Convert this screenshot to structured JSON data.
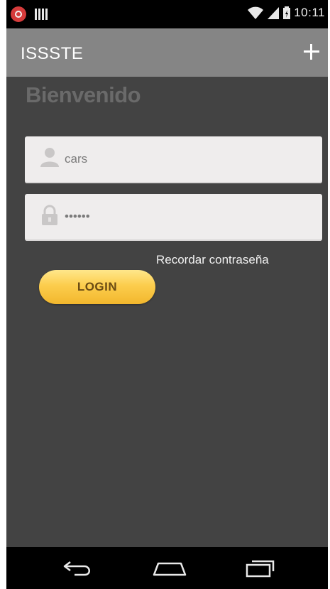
{
  "status_bar": {
    "time": "10:11",
    "icons": [
      "notification-icon",
      "bars-icon",
      "wifi-icon",
      "signal-icon",
      "battery-icon"
    ]
  },
  "action_bar": {
    "title": "ISSSTE",
    "add_button_icon": "plus-icon"
  },
  "main": {
    "welcome": "Bienvenido",
    "username": {
      "value": "cars",
      "icon": "user-icon"
    },
    "password": {
      "value": "••••••",
      "icon": "lock-icon"
    },
    "remember_link": "Recordar contraseña",
    "login_button": "LOGIN"
  },
  "nav_bar": {
    "icons": [
      "back-icon",
      "home-icon",
      "recent-apps-icon"
    ]
  },
  "colors": {
    "background": "#434343",
    "action_bar": "#858585",
    "login_button": "#fccd4d"
  }
}
